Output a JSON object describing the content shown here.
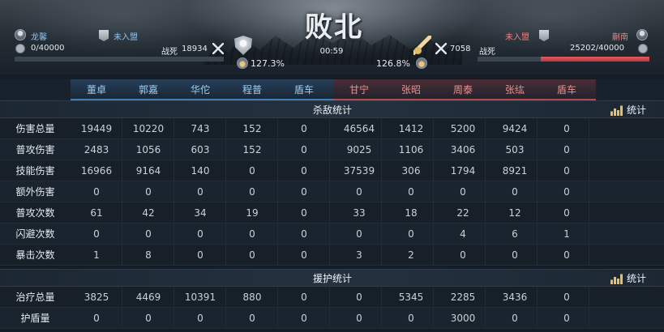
{
  "header": {
    "title": "败北",
    "timer": "00:59",
    "left_player": {
      "name": "龙馨",
      "alliance": "未入盟",
      "troops": "0/40000",
      "troops_fraction": 0.0,
      "deaths_label": "战死",
      "deaths_value": "18934",
      "bonus": "127.3%",
      "name_color": "#8cc4f2"
    },
    "right_player": {
      "name": "蒯南",
      "alliance": "未入盟",
      "troops": "25202/40000",
      "troops_fraction": 0.63,
      "deaths_label": "战死",
      "deaths_value": "7058",
      "bonus": "126.8%",
      "name_color": "#ef7f7f"
    }
  },
  "heroes": {
    "blue": [
      "董卓",
      "郭嘉",
      "华佗",
      "程普",
      "盾车"
    ],
    "red": [
      "甘宁",
      "张昭",
      "周泰",
      "张纮",
      "盾车"
    ]
  },
  "sections": {
    "kill": {
      "title": "杀敌统计",
      "stats_label": "统计"
    },
    "support": {
      "title": "援护统计",
      "stats_label": "统计"
    }
  },
  "rows": [
    {
      "label": "伤害总量",
      "values": [
        "19449",
        "10220",
        "743",
        "152",
        "0",
        "46564",
        "1412",
        "5200",
        "9424",
        "0"
      ]
    },
    {
      "label": "普攻伤害",
      "values": [
        "2483",
        "1056",
        "603",
        "152",
        "0",
        "9025",
        "1106",
        "3406",
        "503",
        "0"
      ]
    },
    {
      "label": "技能伤害",
      "values": [
        "16966",
        "9164",
        "140",
        "0",
        "0",
        "37539",
        "306",
        "1794",
        "8921",
        "0"
      ]
    },
    {
      "label": "额外伤害",
      "values": [
        "0",
        "0",
        "0",
        "0",
        "0",
        "0",
        "0",
        "0",
        "0",
        "0"
      ]
    },
    {
      "label": "普攻次数",
      "values": [
        "61",
        "42",
        "34",
        "19",
        "0",
        "33",
        "18",
        "22",
        "12",
        "0"
      ]
    },
    {
      "label": "闪避次数",
      "values": [
        "0",
        "0",
        "0",
        "0",
        "0",
        "0",
        "0",
        "4",
        "6",
        "1"
      ]
    },
    {
      "label": "暴击次数",
      "values": [
        "1",
        "8",
        "0",
        "0",
        "0",
        "3",
        "2",
        "0",
        "0",
        "0"
      ]
    }
  ],
  "support_rows": [
    {
      "label": "治疗总量",
      "values": [
        "3825",
        "4469",
        "10391",
        "880",
        "0",
        "0",
        "5345",
        "2285",
        "3436",
        "0"
      ]
    },
    {
      "label": "护盾量",
      "values": [
        "0",
        "0",
        "0",
        "0",
        "0",
        "0",
        "0",
        "3000",
        "0",
        "0"
      ]
    }
  ]
}
